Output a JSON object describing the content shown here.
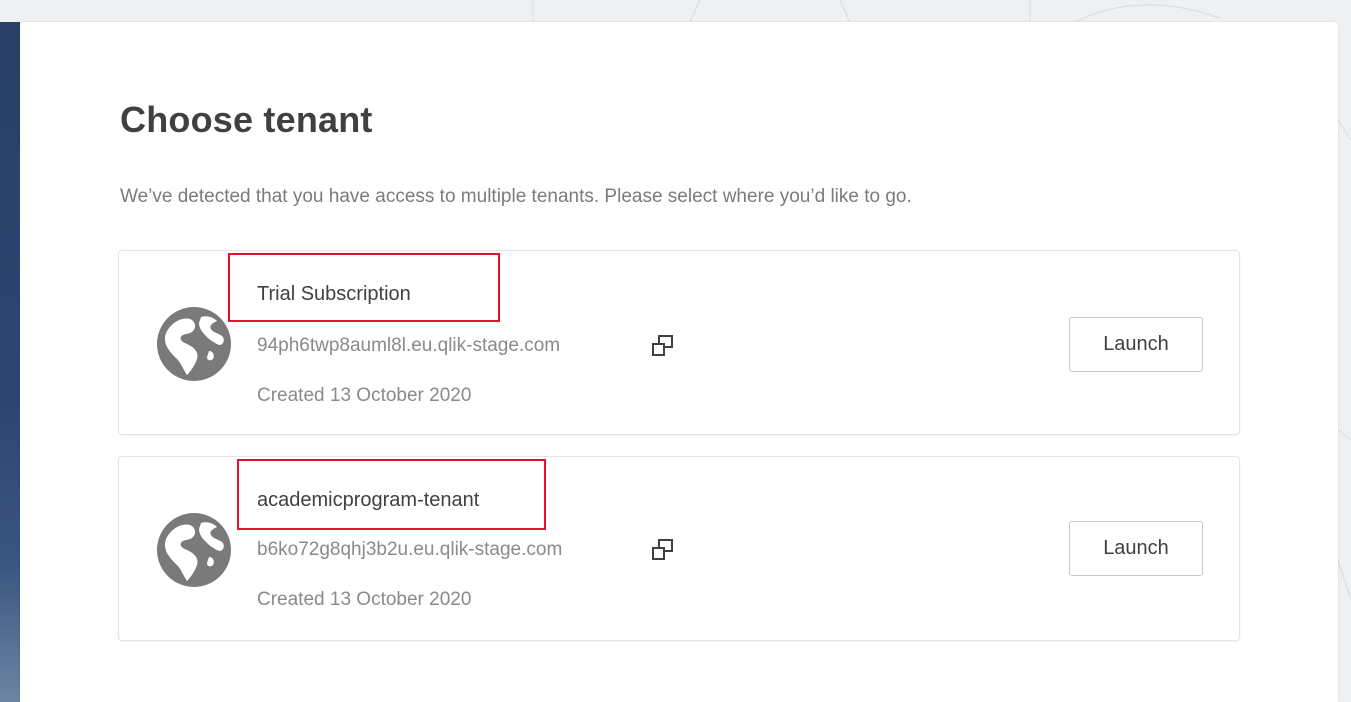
{
  "page": {
    "title": "Choose tenant",
    "subtitle": "We’ve detected that you have access to multiple tenants. Please select where you’d like to go."
  },
  "tenants": [
    {
      "name": "Trial Subscription",
      "url": "94ph6twp8auml8l.eu.qlik-stage.com",
      "created": "Created 13 October 2020",
      "launch_label": "Launch",
      "icon": "globe-icon",
      "copy_icon": "copy-icon",
      "highlighted": true
    },
    {
      "name": "academicprogram-tenant",
      "url": "b6ko72g8qhj3b2u.eu.qlik-stage.com",
      "created": "Created 13 October 2020",
      "launch_label": "Launch",
      "icon": "globe-icon",
      "copy_icon": "copy-icon",
      "highlighted": true
    }
  ],
  "colors": {
    "highlight": "#e8112d",
    "title": "#404040",
    "muted": "#8a8a8a",
    "sidebar": "#2c4570"
  }
}
